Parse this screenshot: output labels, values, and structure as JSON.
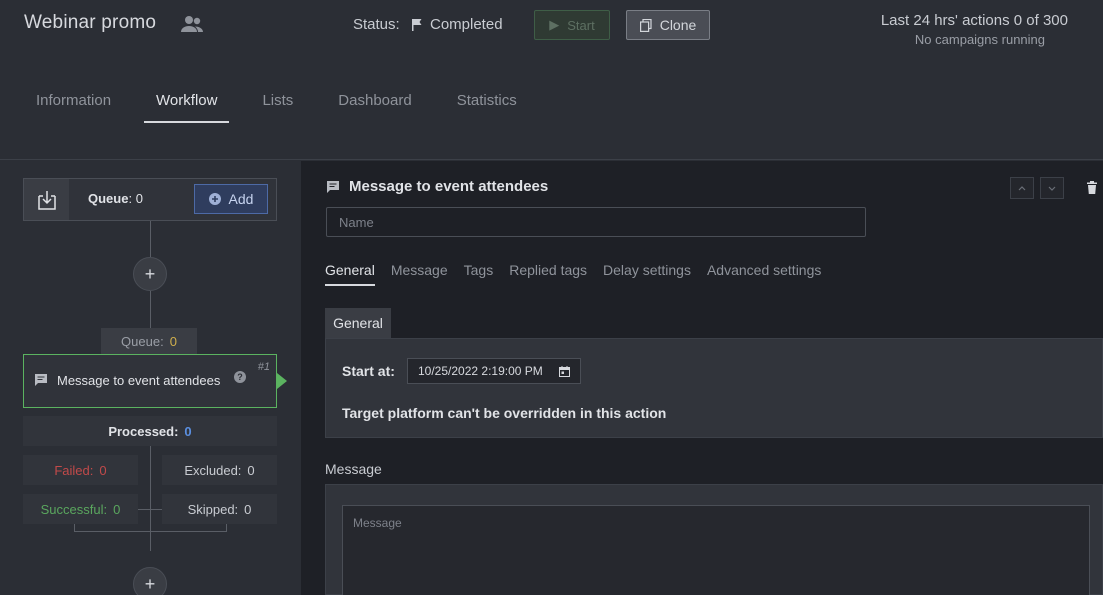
{
  "header": {
    "title": "Webinar promo",
    "status_label": "Status:",
    "status_value": "Completed",
    "start_label": "Start",
    "clone_label": "Clone",
    "actions_summary": "Last 24 hrs' actions 0 of 300",
    "campaigns_status": "No campaigns running"
  },
  "tabs": [
    "Information",
    "Workflow",
    "Lists",
    "Dashboard",
    "Statistics"
  ],
  "active_tab": "Workflow",
  "workflow": {
    "queue_label": "Queue",
    "queue_count": ": 0",
    "add_label": "Add",
    "node_queue_label": "Queue:",
    "node_queue_count": "0",
    "node_name": "Message to event attendees",
    "node_seq": "#1",
    "processed_label": "Processed:",
    "processed_count": "0",
    "failed_label": "Failed:",
    "failed_count": "0",
    "excluded_label": "Excluded:",
    "excluded_count": "0",
    "successful_label": "Successful:",
    "successful_count": "0",
    "skipped_label": "Skipped:",
    "skipped_count": "0"
  },
  "editor": {
    "title": "Message to event attendees",
    "name_placeholder": "Name",
    "sub_tabs": [
      "General",
      "Message",
      "Tags",
      "Replied tags",
      "Delay settings",
      "Advanced settings"
    ],
    "section_tab": "General",
    "start_at_label": "Start at:",
    "start_at_value": "10/25/2022 2:19:00 PM",
    "target_note": "Target platform can't be overridden in this action",
    "message_label": "Message",
    "message_placeholder": "Message"
  },
  "colors": {
    "accent_green": "#5bb360",
    "accent_blue": "#4d6aa6",
    "failed_red": "#c14a4a",
    "queue_yellow": "#d1b04d"
  }
}
